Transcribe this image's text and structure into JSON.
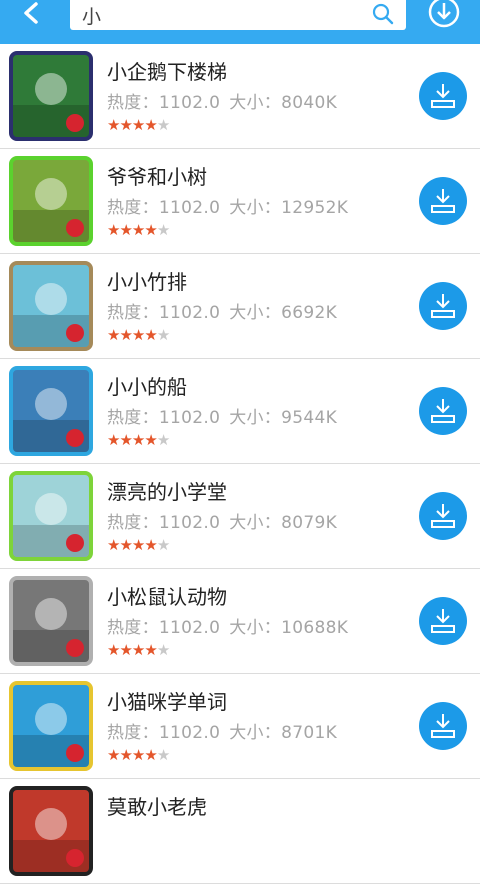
{
  "search": {
    "query": "小"
  },
  "colors": {
    "topbar": "#35aaf1",
    "download_button": "#1c9ae8",
    "star_on": "#e4562b",
    "star_off": "#c9c9c9"
  },
  "labels": {
    "heat": "热度：",
    "size": "大小："
  },
  "apps": [
    {
      "name": "小企鹅下楼梯",
      "heat": "1102.0",
      "size": "8040K",
      "rating": 4,
      "icon": "penguin-stairs-icon",
      "border": "#2b2f6e",
      "bg": "#2f7a38"
    },
    {
      "name": "爷爷和小树",
      "heat": "1102.0",
      "size": "12952K",
      "rating": 4,
      "icon": "grandpa-tree-icon",
      "border": "#5bd22e",
      "bg": "#7aa83a"
    },
    {
      "name": "小小竹排",
      "heat": "1102.0",
      "size": "6692K",
      "rating": 4,
      "icon": "bamboo-raft-icon",
      "border": "#a58a5a",
      "bg": "#6cc0d8"
    },
    {
      "name": "小小的船",
      "heat": "1102.0",
      "size": "9544K",
      "rating": 4,
      "icon": "little-boat-icon",
      "border": "#2ea7e0",
      "bg": "#3b7fb8"
    },
    {
      "name": "漂亮的小学堂",
      "heat": "1102.0",
      "size": "8079K",
      "rating": 4,
      "icon": "school-icon",
      "border": "#7ed43a",
      "bg": "#9ed3d8"
    },
    {
      "name": "小松鼠认动物",
      "heat": "1102.0",
      "size": "10688K",
      "rating": 4,
      "icon": "squirrel-animals-icon",
      "border": "#b0b0b0",
      "bg": "#777777"
    },
    {
      "name": "小猫咪学单词",
      "heat": "1102.0",
      "size": "8701K",
      "rating": 4,
      "icon": "kitten-words-icon",
      "border": "#e6c530",
      "bg": "#2f9ed8"
    },
    {
      "name": "莫敢小老虎",
      "heat": "",
      "size": "",
      "rating": 0,
      "icon": "tiger-icon",
      "border": "#222222",
      "bg": "#c0392b"
    }
  ]
}
